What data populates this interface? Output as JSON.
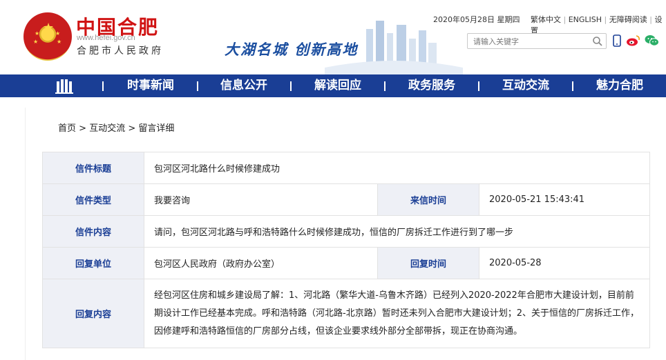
{
  "header": {
    "site_title": "中国合肥",
    "site_domain": "www.hefei.gov.cn",
    "site_subtitle": "合肥市人民政府",
    "slogan": "大湖名城  创新高地",
    "date": "2020年05月28日 星期四",
    "links": [
      "繁体中文",
      "ENGLISH",
      "无障碍阅读",
      "设置"
    ],
    "search_placeholder": "请输入关键字"
  },
  "nav": {
    "items": [
      "时事新闻",
      "信息公开",
      "解读回应",
      "政务服务",
      "互动交流",
      "魅力合肥"
    ]
  },
  "breadcrumb": [
    "首页",
    "互动交流",
    "留言详细"
  ],
  "breadcrumb_sep": ">",
  "letter": {
    "title_label": "信件标题",
    "title": "包河区河北路什么时候修建成功",
    "type_label": "信件类型",
    "type": "我要咨询",
    "date_label": "来信时间",
    "date": "2020-05-21 15:43:41",
    "content_label": "信件内容",
    "content": "请问，包河区河北路与呼和浩特路什么时候修建成功，恒信的厂房拆迁工作进行到了哪一步",
    "reply_unit_label": "回复单位",
    "reply_unit": "包河区人民政府（政府办公室）",
    "reply_date_label": "回复时间",
    "reply_date": "2020-05-28",
    "reply_content_label": "回复内容",
    "reply_content": "经包河区住房和城乡建设局了解：1、河北路（繁华大道-乌鲁木齐路）已经列入2020-2022年合肥市大建设计划，目前前期设计工作已经基本完成。呼和浩特路（河北路-北京路）暂时还未列入合肥市大建设计划；2、关于恒信的厂房拆迁工作，因修建呼和浩特路恒信的厂房部分占线，但该企业要求线外部分全部带拆，现正在协商沟通。"
  },
  "colors": {
    "brand_red": "#d01313",
    "nav_blue": "#1a3e95",
    "label_bg": "#eef0f6"
  }
}
